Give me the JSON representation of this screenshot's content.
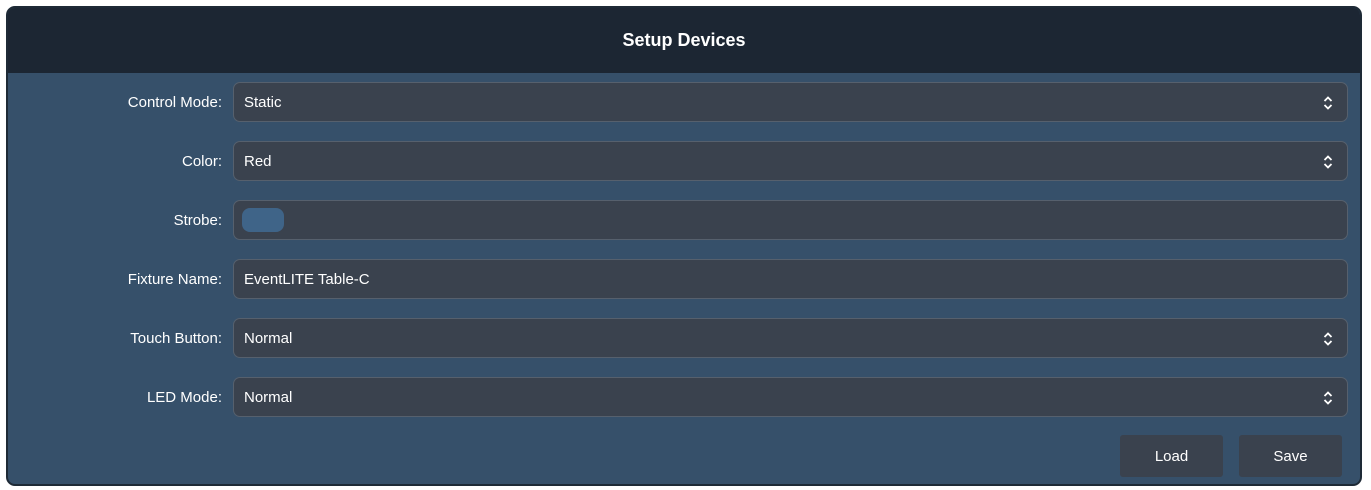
{
  "header": {
    "title": "Setup Devices"
  },
  "form": {
    "control_mode": {
      "label": "Control Mode:",
      "value": "Static"
    },
    "color": {
      "label": "Color:",
      "value": "Red"
    },
    "strobe": {
      "label": "Strobe:",
      "enabled": false
    },
    "fixture_name": {
      "label": "Fixture Name:",
      "value": "EventLITE Table-C"
    },
    "touch_button": {
      "label": "Touch Button:",
      "value": "Normal"
    },
    "led_mode": {
      "label": "LED Mode:",
      "value": "Normal"
    }
  },
  "actions": {
    "load_label": "Load",
    "save_label": "Save"
  },
  "icons": {
    "select_arrow": "chevron-up-down-icon"
  },
  "colors": {
    "panel_bg": "#36506a",
    "header_bg": "#1c2633",
    "field_bg": "#3a424e",
    "toggle_off": "#3f6488"
  }
}
